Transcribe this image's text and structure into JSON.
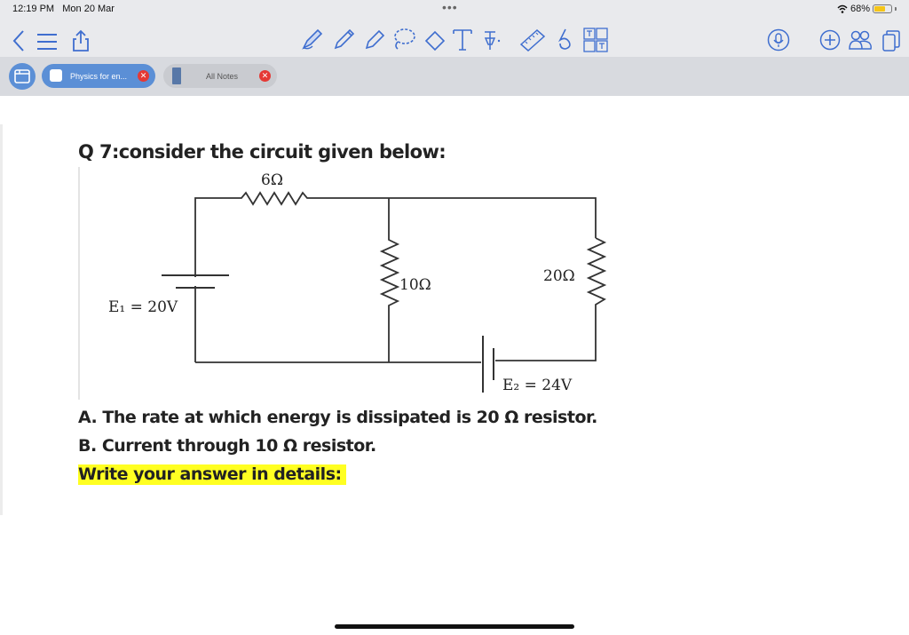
{
  "status_bar": {
    "time": "12:19 PM",
    "date": "Mon 20 Mar",
    "battery_text": "68%",
    "battery_level": 0.68,
    "more_dots": "•••"
  },
  "toolbar": {
    "left_icons": [
      "back-chevron-icon",
      "list-icon",
      "share-icon"
    ],
    "tools": [
      "pen-icon",
      "pencil-icon",
      "highlighter-icon",
      "lasso-icon",
      "eraser-icon",
      "text-icon",
      "pin-icon",
      "ruler-icon",
      "shapes-icon",
      "template-icon"
    ],
    "right_icons": [
      "microphone-icon",
      "add-icon",
      "users-icon",
      "pages-icon"
    ],
    "accent": "#3f6ecf"
  },
  "tabs": [
    {
      "label": "Physics for en...",
      "active": true
    },
    {
      "label": "All Notes",
      "active": false
    }
  ],
  "content": {
    "question": "Q 7:consider the circuit given below:",
    "circuit": {
      "r1": "6Ω",
      "r2": "10Ω",
      "r3": "20Ω",
      "e1": "E₁ = 20V",
      "e2": "E₂ = 24V"
    },
    "answer_a": "A. The rate at which energy is dissipated is 20 Ω resistor.",
    "answer_b": "B. Current through 10 Ω resistor.",
    "instruction": "Write your answer in details:",
    "highlight_color": "#ffff22"
  }
}
